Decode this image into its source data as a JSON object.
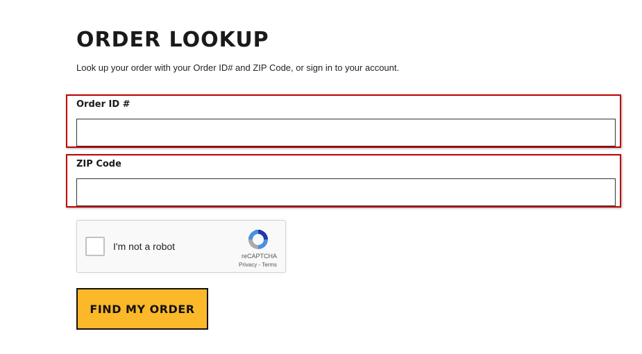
{
  "page": {
    "title": "ORDER LOOKUP",
    "subtitle": "Look up your order with your Order ID# and ZIP Code, or sign in to your account."
  },
  "form": {
    "order_id": {
      "label": "Order ID #",
      "value": "",
      "placeholder": ""
    },
    "zip_code": {
      "label": "ZIP Code",
      "value": "",
      "placeholder": ""
    },
    "submit_label": "FIND MY ORDER"
  },
  "captcha": {
    "checkbox_label": "I'm not a robot",
    "brand": "reCAPTCHA",
    "privacy": "Privacy",
    "separator": " - ",
    "terms": "Terms",
    "icon": "recaptcha-logo-icon"
  },
  "colors": {
    "highlight_border": "#c00000",
    "button_bg": "#fbb829",
    "text": "#1a1a1a"
  }
}
